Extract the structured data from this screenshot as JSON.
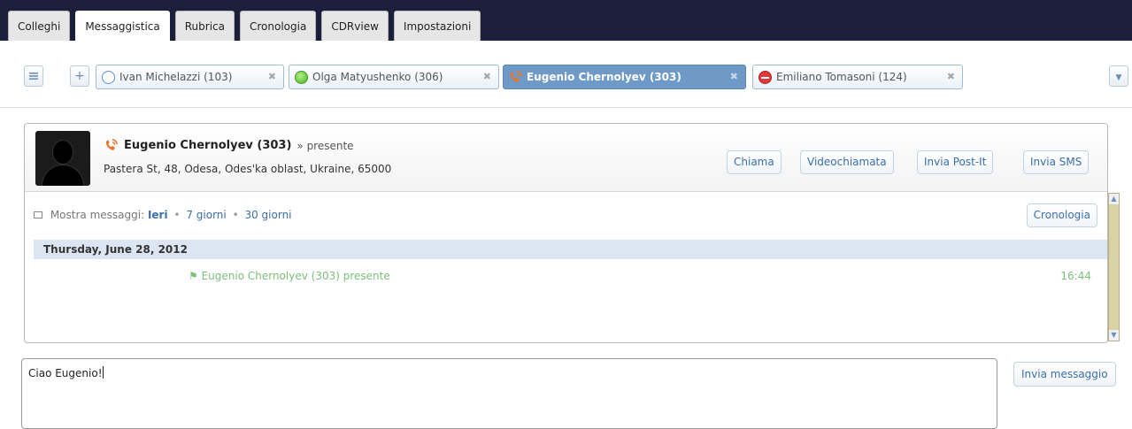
{
  "top_tabs": [
    "Colleghi",
    "Messaggistica",
    "Rubrica",
    "Cronologia",
    "CDRview",
    "Impostazioni"
  ],
  "active_top_tab": "Messaggistica",
  "toolbar": {
    "menu_icon": "menu-icon",
    "add_icon": "plus-icon"
  },
  "contact_tabs": [
    {
      "label": "Ivan Michelazzi (103)",
      "status": "offline",
      "close": "✖"
    },
    {
      "label": "Olga Matyushenko (306)",
      "status": "online",
      "close": "✖"
    },
    {
      "label": "Eugenio Chernolyev (303)",
      "status": "on-call",
      "close": "✖"
    },
    {
      "label": "Emiliano Tomasoni (124)",
      "status": "do-not-disturb",
      "close": "✖"
    }
  ],
  "contact": {
    "name": "Eugenio Chernolyev (303)",
    "presence": "» presente",
    "address": "Pastera St, 48, Odesa, Odes'ka oblast, Ukraine, 65000"
  },
  "actions": {
    "call": "Chiama",
    "video": "Videochiamata",
    "postit": "Invia Post-It",
    "sms": "Invia SMS"
  },
  "messages": {
    "filter_label": "Mostra messaggi:",
    "filter_options": [
      "Ieri",
      "7 giorni",
      "30 giorni"
    ],
    "dot": "•",
    "history_button": "Cronologia",
    "day_header": "Thursday, June 28, 2012",
    "event_text": "Eugenio Chernolyev (303) presente",
    "event_time": "16:44"
  },
  "compose": {
    "text": "Ciao Eugenio!",
    "send_button": "Invia messaggio"
  },
  "colors": {
    "topbar": "#1b1f3b",
    "accent": "#6f9ac8",
    "link": "#3b6fa8",
    "event_green": "#7cc07c",
    "day_header_bg": "#dbe6f2"
  }
}
